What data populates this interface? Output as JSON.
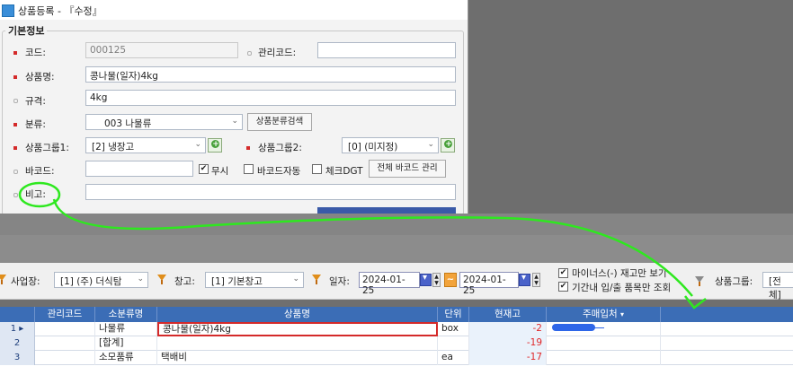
{
  "window": {
    "title": "상품등록 - 『수정』"
  },
  "group_title": "기본정보",
  "form": {
    "code_label": "코드:",
    "code_value": "000125",
    "mgmt_code_label": "관리코드:",
    "mgmt_code_value": "",
    "name_label": "상품명:",
    "name_value": "콩나물(일자)4kg",
    "spec_label": "규격:",
    "spec_value": "4kg",
    "category_label": "분류:",
    "category_value": "003 나물류",
    "category_search_button": "상품분류검색",
    "group1_label": "상품그룹1:",
    "group1_value": "[2] 냉장고",
    "group2_label": "상품그룹2:",
    "group2_value": "[0] (미지정)",
    "barcode_label": "바코드:",
    "barcode_value": "",
    "ignore_label": "무시",
    "ignore_checked": true,
    "barcode_auto_label": "바코드자동",
    "barcode_auto_checked": false,
    "check_dgt_label": "체크DGT",
    "check_dgt_checked": false,
    "all_barcode_button": "전체 바코드 관리",
    "memo_label": "비고:",
    "memo_value": ""
  },
  "toolbar": {
    "business_label": "사업장:",
    "business_value": "[1] (주) 더식탐",
    "warehouse_label": "창고:",
    "warehouse_value": "[1] 기본창고",
    "date_label": "일자:",
    "date_from": "2024-01-25",
    "date_to": "2024-01-25",
    "tilde": "~",
    "minus_stock_label": "마이너스(-) 재고만 보기",
    "minus_stock_checked": true,
    "period_io_label": "기간내 입/출 품목만 조회",
    "period_io_checked": true,
    "product_group_label": "상품그룹:",
    "product_group_value": "[전체]"
  },
  "grid": {
    "columns": [
      "관리코드",
      "소분류명",
      "상품명",
      "단위",
      "현재고",
      "주매입처"
    ],
    "rows": [
      {
        "no": "1",
        "mgmt": "",
        "sub": "나물류",
        "name": "콩나물(일자)4kg",
        "unit": "box",
        "stock": "-2",
        "vendor": ""
      },
      {
        "no": "2",
        "mgmt": "",
        "sub": "[합계]",
        "name": "",
        "unit": "",
        "stock": "-19",
        "vendor": ""
      },
      {
        "no": "3",
        "mgmt": "",
        "sub": "소모품류",
        "name": "택배비",
        "unit": "ea",
        "stock": "-17",
        "vendor": ""
      }
    ]
  },
  "colors": {
    "header_blue": "#3b6db6",
    "negative_red": "#e0282a",
    "annotation_green": "#2ee81f"
  }
}
